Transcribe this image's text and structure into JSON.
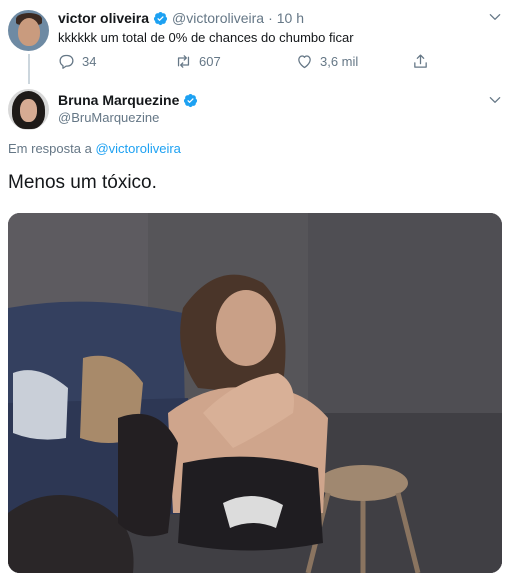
{
  "reply_tweet": {
    "author_name": "victor oliveira",
    "author_handle": "@victoroliveira",
    "separator": "·",
    "time": "10 h",
    "text": "kkkkkk um total de 0% de chances do chumbo ficar",
    "stats": {
      "replies": "34",
      "retweets": "607",
      "likes": "3,6 mil"
    }
  },
  "main_tweet": {
    "author_name": "Bruna Marquezine",
    "author_handle": "@BruMarquezine",
    "reply_prefix": "Em resposta a",
    "reply_handle": "@victoroliveira",
    "text": "Menos um tóxico."
  },
  "colors": {
    "verified": "#1da1f2",
    "link": "#1da1f2",
    "muted": "#657786",
    "text": "#14171a"
  },
  "icons": {
    "verified": "verified-badge-icon",
    "chevron": "chevron-down-icon",
    "reply": "reply-icon",
    "retweet": "retweet-icon",
    "like": "heart-icon",
    "share": "share-icon"
  }
}
